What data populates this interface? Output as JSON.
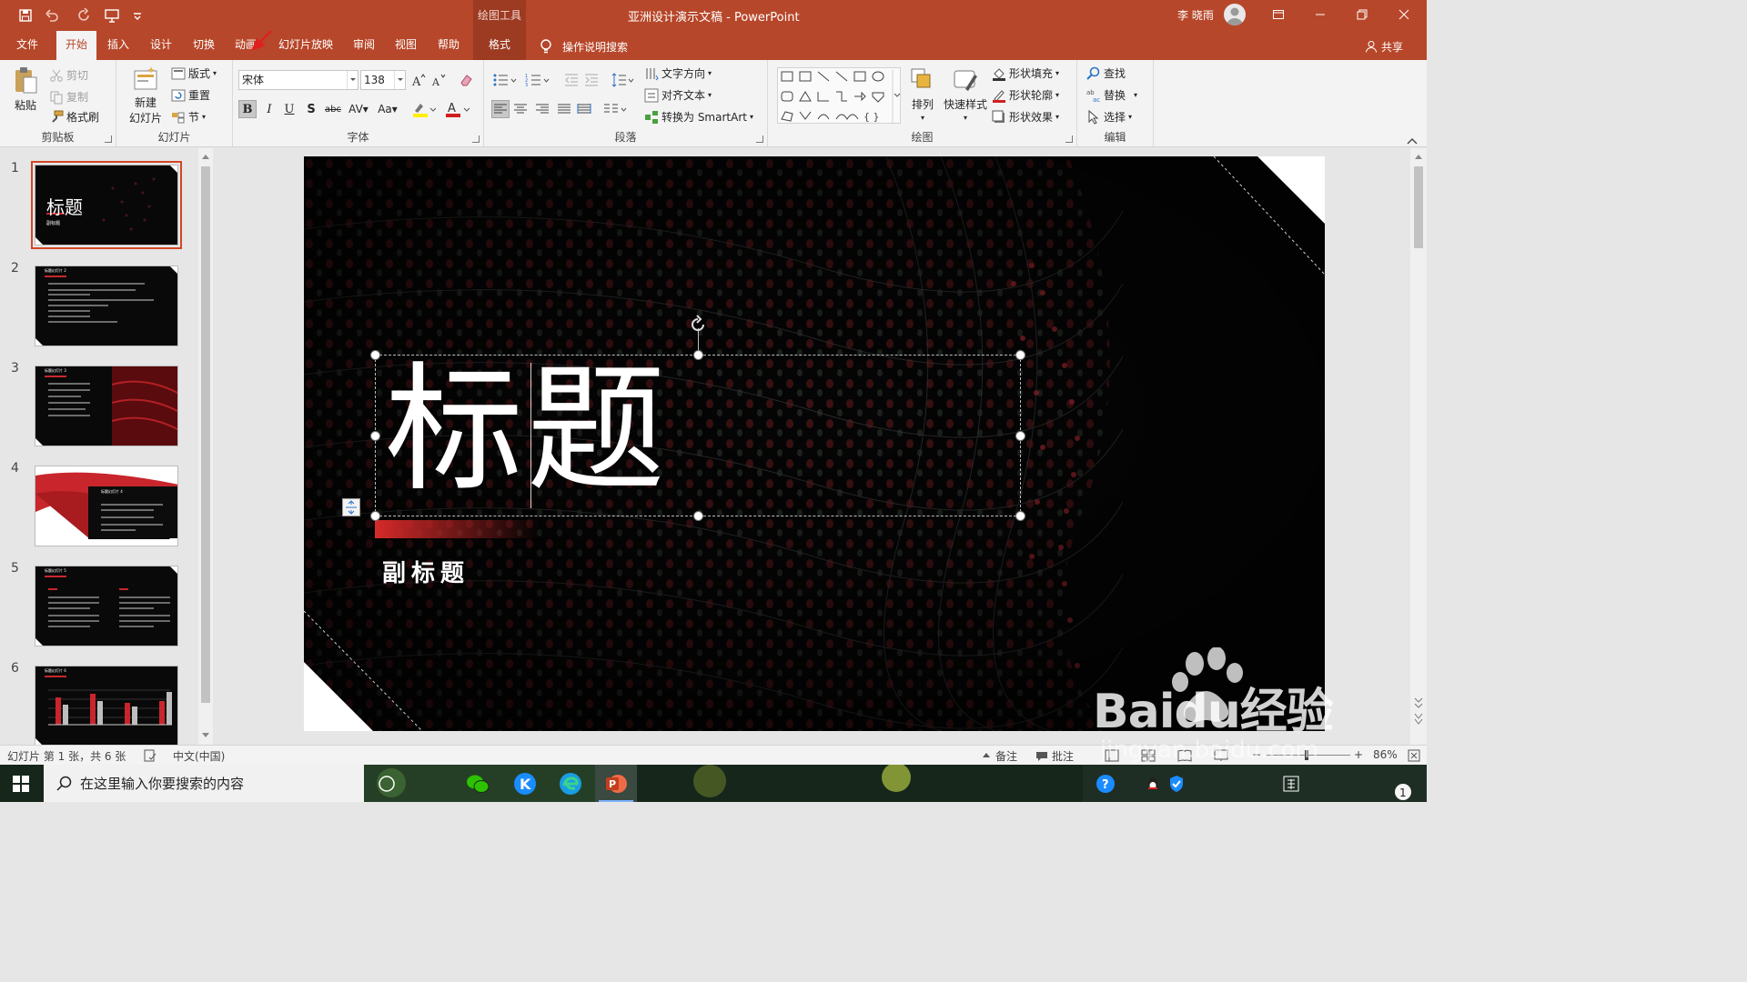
{
  "titlebar": {
    "context_tool_label": "绘图工具",
    "document_title": "亚洲设计演示文稿  -  PowerPoint",
    "user_name": "李 晓雨"
  },
  "tabs": [
    {
      "label": "文件"
    },
    {
      "label": "开始"
    },
    {
      "label": "插入"
    },
    {
      "label": "设计"
    },
    {
      "label": "切换"
    },
    {
      "label": "动画"
    },
    {
      "label": "幻灯片放映"
    },
    {
      "label": "审阅"
    },
    {
      "label": "视图"
    },
    {
      "label": "帮助"
    },
    {
      "label": "格式"
    }
  ],
  "tell_me": "操作说明搜索",
  "share": "共享",
  "ribbon": {
    "clipboard": {
      "label": "剪贴板",
      "paste": "粘贴",
      "cut": "剪切",
      "copy": "复制",
      "format_painter": "格式刷"
    },
    "slides": {
      "label": "幻灯片",
      "new_slide_line1": "新建",
      "new_slide_line2": "幻灯片",
      "layout": "版式",
      "reset": "重置",
      "section": "节"
    },
    "font": {
      "label": "字体",
      "font_name": "宋体",
      "font_size": "138"
    },
    "paragraph": {
      "label": "段落",
      "text_direction": "文字方向",
      "align_text": "对齐文本",
      "convert_smartart": "转换为 SmartArt"
    },
    "drawing": {
      "label": "绘图",
      "arrange": "排列",
      "quick_styles": "快速样式",
      "shape_fill": "形状填充",
      "shape_outline": "形状轮廓",
      "shape_effects": "形状效果"
    },
    "editing": {
      "label": "编辑",
      "find": "查找",
      "replace": "替换",
      "select": "选择"
    }
  },
  "thumbnails": [
    {
      "number": "1",
      "title": "标题",
      "subtitle": "副标题"
    },
    {
      "number": "2",
      "title": "标题幻灯片 2"
    },
    {
      "number": "3",
      "title": "标题幻灯片 3"
    },
    {
      "number": "4",
      "title": "标题幻灯片 4"
    },
    {
      "number": "5",
      "title": "标题幻灯片 5"
    },
    {
      "number": "6",
      "title": "标题幻灯片 6"
    }
  ],
  "slide": {
    "title": "标题",
    "subtitle": "副标题"
  },
  "statusbar": {
    "slide_info": "幻灯片 第 1 张，共 6 张",
    "language": "中文(中国)",
    "notes": "备注",
    "comments": "批注",
    "zoom": "86%"
  },
  "taskbar": {
    "search_placeholder": "在这里输入你要搜索的内容"
  },
  "watermark": {
    "brand": "Baidu经验",
    "url": "jingyan.baidu.com"
  },
  "colors": {
    "accent": "#b7472a",
    "selection": "#d24726",
    "slide_bg": "#050505",
    "slide_red": "#c8262c"
  }
}
